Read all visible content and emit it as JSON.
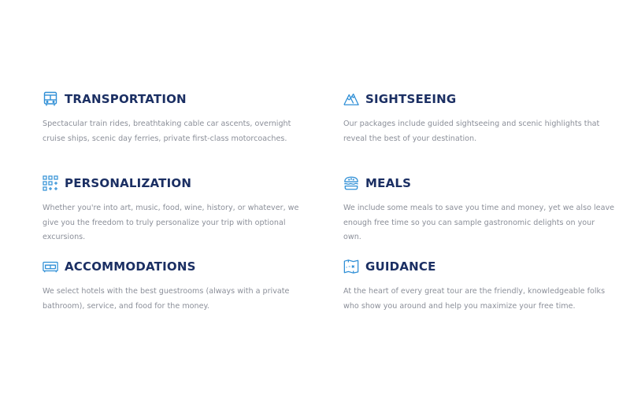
{
  "colors": {
    "accent": "#2f8fd6",
    "heading": "#1b2f63",
    "body": "#8b8f99"
  },
  "features": [
    {
      "icon": "bus-icon",
      "title": "TRANSPORTATION",
      "desc": "Spectacular train rides, breathtaking cable car ascents, overnight cruise ships, scenic day ferries, private first-class motorcoaches."
    },
    {
      "icon": "mountains-icon",
      "title": "SIGHTSEEING",
      "desc": "Our packages include guided sightseeing and scenic highlights that reveal the best of your destination."
    },
    {
      "icon": "grid-plus-icon",
      "title": "PERSONALIZATION",
      "desc": "Whether you're into art, music, food, wine, history, or whatever, we give you the freedom to truly personalize your trip with optional excursions."
    },
    {
      "icon": "burger-icon",
      "title": "MEALS",
      "desc": "We include some meals to save you time and money, yet we also leave enough free time so you can sample gastronomic delights on your own."
    },
    {
      "icon": "sofa-icon",
      "title": "ACCOMMODATIONS",
      "desc": "We select hotels with the best guestrooms (always with a private bathroom), service, and food for the money."
    },
    {
      "icon": "map-icon",
      "title": "GUIDANCE",
      "desc": "At the heart of every great tour are the friendly, knowledgeable folks who show you around and help you maximize your free time."
    }
  ]
}
